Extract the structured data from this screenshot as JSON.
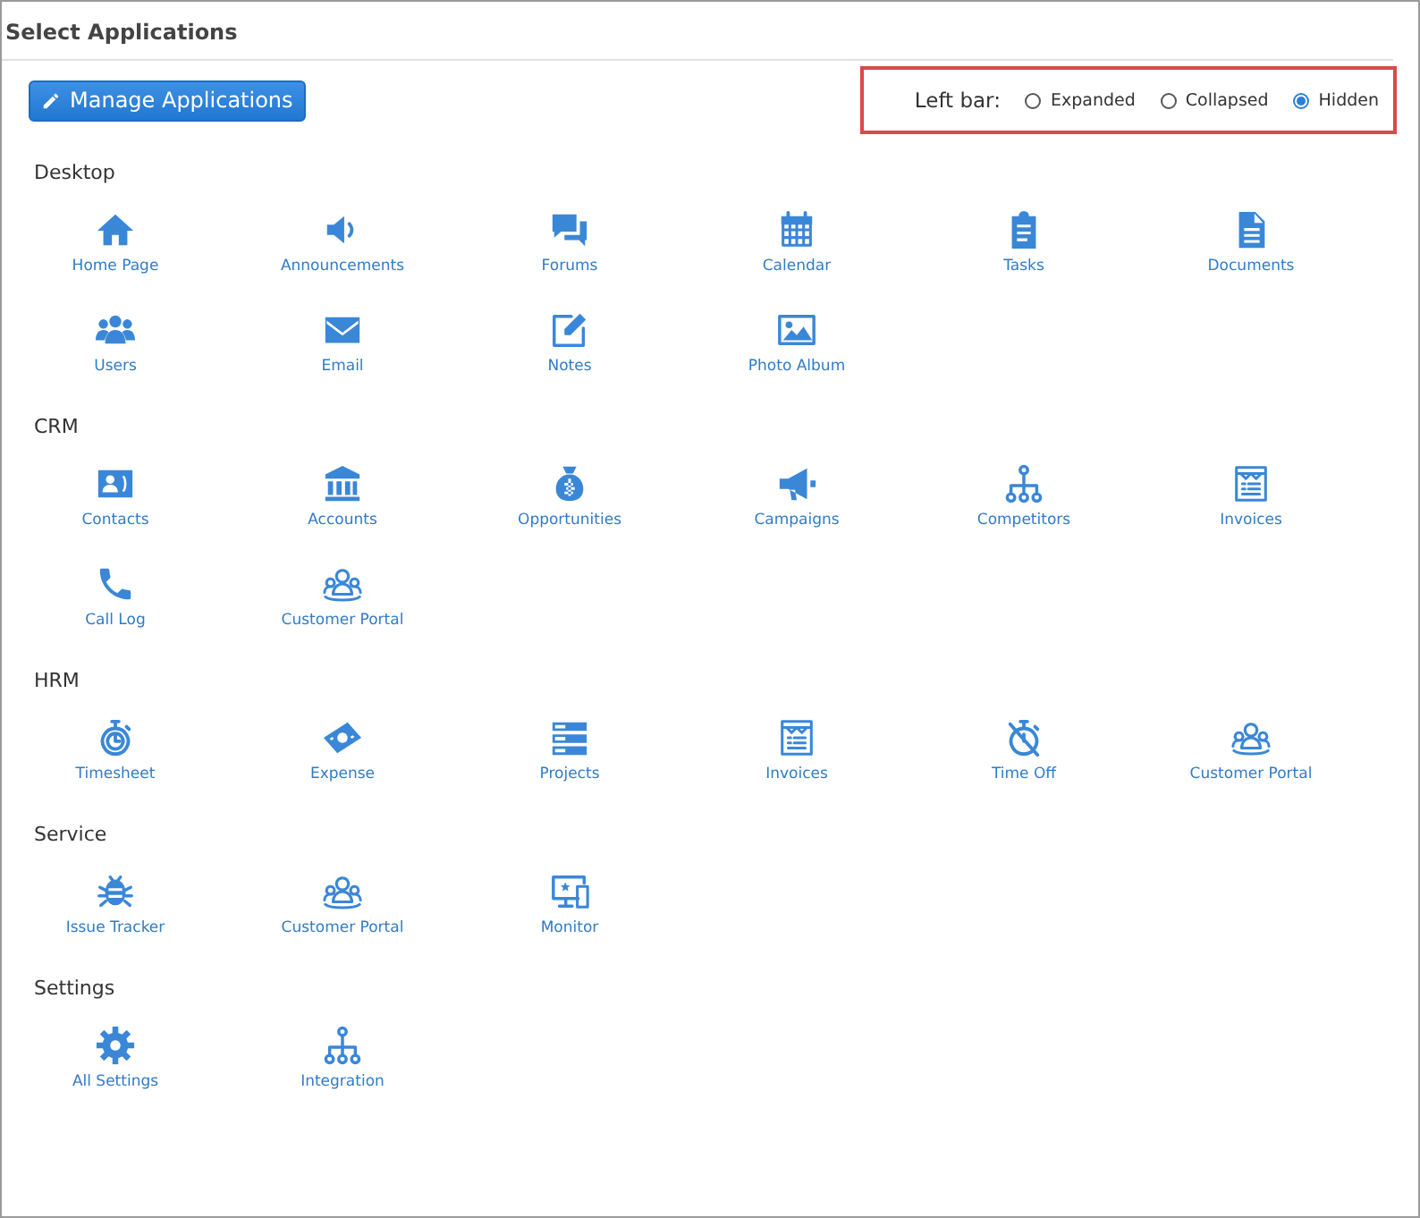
{
  "window": {
    "title": "Select Applications"
  },
  "manage_button": {
    "label": "Manage Applications"
  },
  "left_bar": {
    "label": "Left bar:",
    "options": [
      {
        "label": "Expanded",
        "selected": false
      },
      {
        "label": "Collapsed",
        "selected": false
      },
      {
        "label": "Hidden",
        "selected": true
      }
    ]
  },
  "sections": [
    {
      "title": "Desktop",
      "apps": [
        {
          "label": "Home Page",
          "kind": "home"
        },
        {
          "label": "Announcements",
          "kind": "speaker"
        },
        {
          "label": "Forums",
          "kind": "chat"
        },
        {
          "label": "Calendar",
          "kind": "calendar"
        },
        {
          "label": "Tasks",
          "kind": "clipboard"
        },
        {
          "label": "Documents",
          "kind": "document"
        },
        {
          "label": "Users",
          "kind": "users"
        },
        {
          "label": "Email",
          "kind": "envelope"
        },
        {
          "label": "Notes",
          "kind": "pencil"
        },
        {
          "label": "Photo Album",
          "kind": "image"
        }
      ]
    },
    {
      "title": "CRM",
      "apps": [
        {
          "label": "Contacts",
          "kind": "contact"
        },
        {
          "label": "Accounts",
          "kind": "bank"
        },
        {
          "label": "Opportunities",
          "kind": "moneybag"
        },
        {
          "label": "Campaigns",
          "kind": "megaphone"
        },
        {
          "label": "Competitors",
          "kind": "hierarchy"
        },
        {
          "label": "Invoices",
          "kind": "invoice"
        },
        {
          "label": "Call Log",
          "kind": "phone"
        },
        {
          "label": "Customer Portal",
          "kind": "group"
        }
      ]
    },
    {
      "title": "HRM",
      "apps": [
        {
          "label": "Timesheet",
          "kind": "stopwatch"
        },
        {
          "label": "Expense",
          "kind": "banknote"
        },
        {
          "label": "Projects",
          "kind": "stack"
        },
        {
          "label": "Invoices",
          "kind": "invoice"
        },
        {
          "label": "Time Off",
          "kind": "stopwatchoff"
        },
        {
          "label": "Customer Portal",
          "kind": "group"
        }
      ]
    },
    {
      "title": "Service",
      "apps": [
        {
          "label": "Issue Tracker",
          "kind": "bug"
        },
        {
          "label": "Customer Portal",
          "kind": "group"
        },
        {
          "label": "Monitor",
          "kind": "monitor"
        }
      ]
    },
    {
      "title": "Settings",
      "apps": [
        {
          "label": "All Settings",
          "kind": "gear"
        },
        {
          "label": "Integration",
          "kind": "hierarchy"
        }
      ]
    }
  ]
}
